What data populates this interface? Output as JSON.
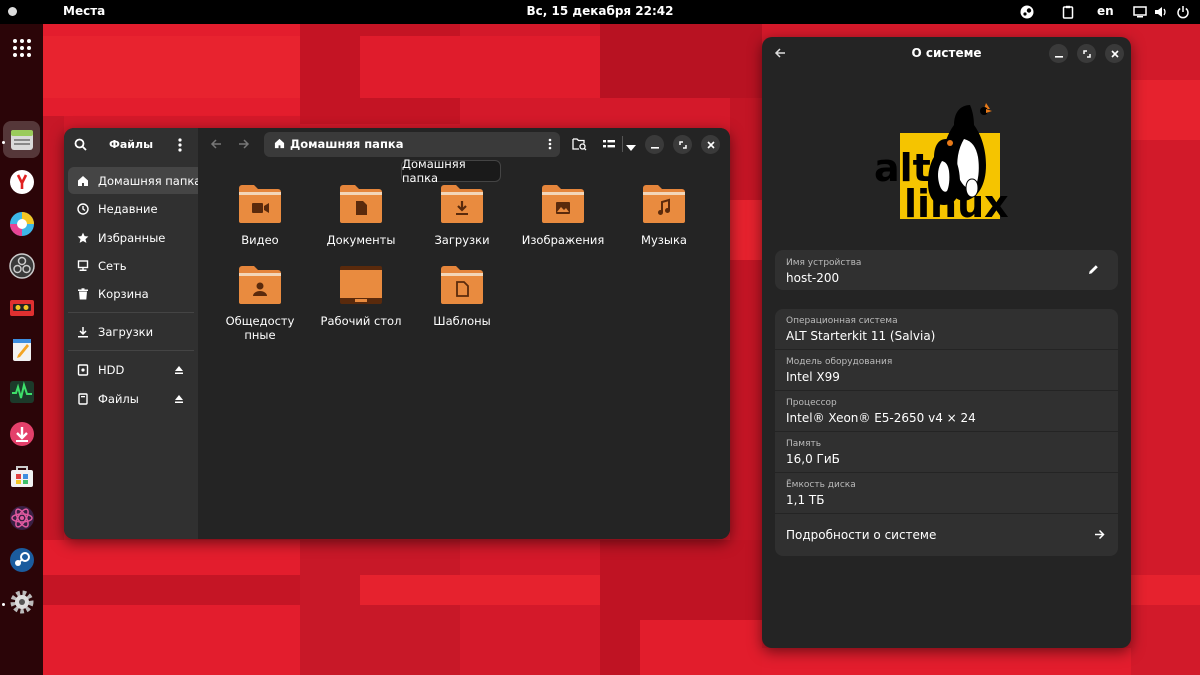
{
  "topbar": {
    "places": "Места",
    "clock": "Вс, 15 декабря  22:42",
    "lang": "en"
  },
  "dock": {
    "items": [
      "apps-grid-icon",
      "files-icon",
      "yandex-browser-icon",
      "paint-icon",
      "obs-icon",
      "tape-recorder-icon",
      "text-editor-icon",
      "system-monitor-icon",
      "downloader-icon",
      "software-center-icon",
      "atom-icon",
      "steam-icon",
      "settings-icon"
    ]
  },
  "files": {
    "title": "Файлы",
    "path": "Домашняя папка",
    "tooltip": "Домашняя папка",
    "sidebar": [
      {
        "label": "Домашняя папка",
        "icon": "home-icon"
      },
      {
        "label": "Недавние",
        "icon": "clock-icon"
      },
      {
        "label": "Избранные",
        "icon": "star-icon"
      },
      {
        "label": "Сеть",
        "icon": "network-icon"
      },
      {
        "label": "Корзина",
        "icon": "trash-icon"
      },
      {
        "label": "Загрузки",
        "icon": "download-icon"
      },
      {
        "label": "HDD",
        "icon": "drive-icon"
      },
      {
        "label": "Файлы",
        "icon": "drive-icon"
      }
    ],
    "folders": [
      {
        "label": "Видео",
        "icon": "video-folder-icon"
      },
      {
        "label": "Документы",
        "icon": "documents-folder-icon"
      },
      {
        "label": "Загрузки",
        "icon": "downloads-folder-icon"
      },
      {
        "label": "Изображения",
        "icon": "pictures-folder-icon"
      },
      {
        "label": "Музыка",
        "icon": "music-folder-icon"
      },
      {
        "label": "Общедоступные",
        "icon": "public-folder-icon"
      },
      {
        "label": "Рабочий стол",
        "icon": "desktop-folder-icon"
      },
      {
        "label": "Шаблоны",
        "icon": "templates-folder-icon"
      }
    ]
  },
  "about": {
    "title": "О системе",
    "logo_text_1": "alt",
    "logo_text_2": "linux",
    "device_name_label": "Имя устройства",
    "device_name": "host-200",
    "info": [
      {
        "key": "Операционная система",
        "value": "ALT Starterkit 11 (Salvia)"
      },
      {
        "key": "Модель оборудования",
        "value": "Intel X99"
      },
      {
        "key": "Процессор",
        "value": "Intel® Xeon® E5-2650 v4 × 24"
      },
      {
        "key": "Память",
        "value": "16,0 ГиБ"
      },
      {
        "key": "Ёмкость диска",
        "value": "1,1 ТБ"
      }
    ],
    "details": "Подробности о системе"
  },
  "colors": {
    "folder_orange": "#e5853b",
    "wallpaper_red": "#d4192a",
    "window_dark": "#242424"
  }
}
